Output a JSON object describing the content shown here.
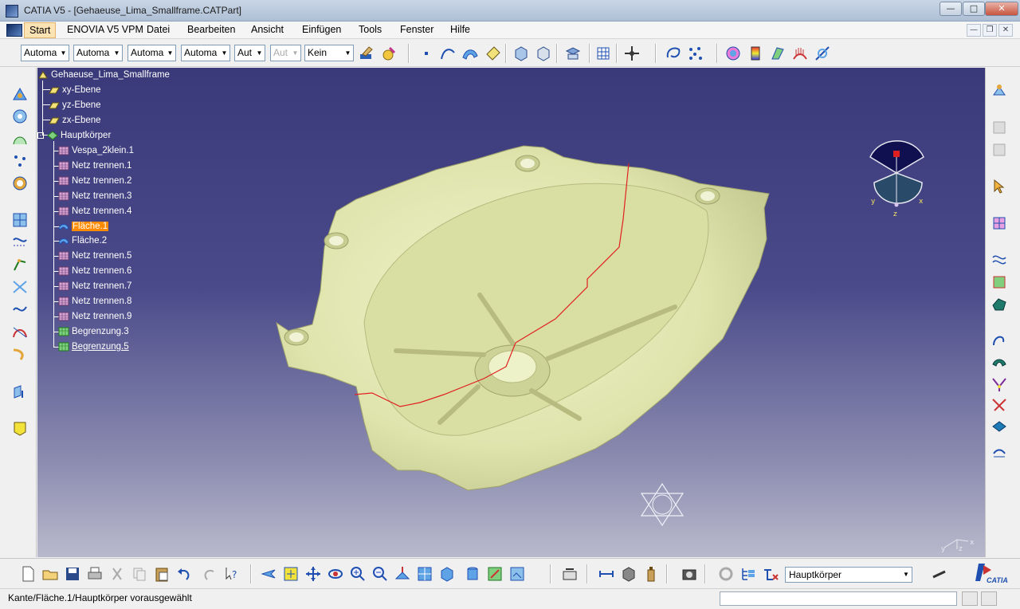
{
  "window": {
    "title": "CATIA V5 - [Gehaeuse_Lima_Smallframe.CATPart]",
    "controls": [
      "—",
      "□",
      "✕"
    ]
  },
  "menu": {
    "items": [
      "Start",
      "ENOVIA V5 VPM",
      "Datei",
      "Bearbeiten",
      "Ansicht",
      "Einfügen",
      "Tools",
      "Fenster",
      "Hilfe"
    ],
    "mdi_controls": [
      "—",
      "❐",
      "✕"
    ]
  },
  "toolbar": {
    "combos": [
      {
        "value": "Automa",
        "disabled": false
      },
      {
        "value": "Automa",
        "disabled": false
      },
      {
        "value": "Automa",
        "disabled": false
      },
      {
        "value": "Automa",
        "disabled": false
      },
      {
        "value": "Aut",
        "disabled": false
      },
      {
        "value": "Aut",
        "disabled": true
      },
      {
        "value": "Kein",
        "disabled": false
      }
    ]
  },
  "tree": {
    "root": "Gehaeuse_Lima_Smallframe",
    "planes": [
      "xy-Ebene",
      "yz-Ebene",
      "zx-Ebene"
    ],
    "body": "Hauptkörper",
    "features": [
      {
        "label": "Vespa_2klein.1",
        "icon": "mesh-icon"
      },
      {
        "label": "Netz trennen.1",
        "icon": "mesh-icon"
      },
      {
        "label": "Netz trennen.2",
        "icon": "mesh-icon"
      },
      {
        "label": "Netz trennen.3",
        "icon": "mesh-icon"
      },
      {
        "label": "Netz trennen.4",
        "icon": "mesh-icon"
      },
      {
        "label": "Fläche.1",
        "icon": "surface-icon",
        "selected": true
      },
      {
        "label": "Fläche.2",
        "icon": "surface-icon"
      },
      {
        "label": "Netz trennen.5",
        "icon": "mesh-icon"
      },
      {
        "label": "Netz trennen.6",
        "icon": "mesh-icon"
      },
      {
        "label": "Netz trennen.7",
        "icon": "mesh-icon"
      },
      {
        "label": "Netz trennen.8",
        "icon": "mesh-icon"
      },
      {
        "label": "Netz trennen.9",
        "icon": "mesh-icon"
      },
      {
        "label": "Begrenzung.3",
        "icon": "boundary-icon"
      },
      {
        "label": "Begrenzung.5",
        "icon": "boundary-icon",
        "underlined": true
      }
    ]
  },
  "compass": {
    "axes": [
      "x",
      "y",
      "z"
    ]
  },
  "axis_triad": {
    "labels": [
      "y",
      "z",
      "x"
    ]
  },
  "bottom": {
    "body_select": "Hauptkörper",
    "brand": "CATIA"
  },
  "status": {
    "message": "Kante/Fläche.1/Hauptkörper vorausgewählt",
    "command_input": ""
  }
}
